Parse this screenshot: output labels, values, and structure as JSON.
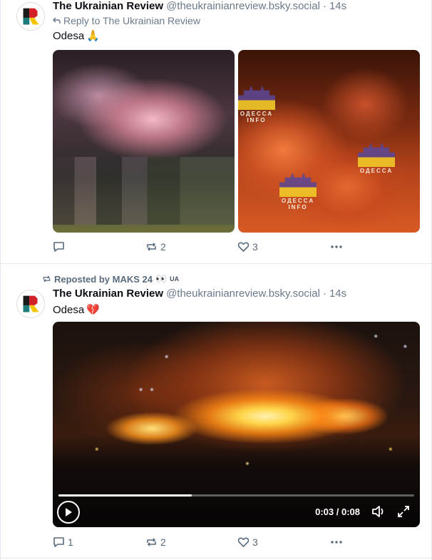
{
  "post1": {
    "author_name": "The Ukrainian Review",
    "author_handle": "@theukrainianreview.bsky.social",
    "separator": "·",
    "time": "14s",
    "reply_to": "Reply to The Ukrainian Review",
    "text": "Odesa",
    "emoji": "🙏",
    "image_watermark": "ОДЕССА",
    "image_watermark_sub": "INFO",
    "replies": "",
    "reposts": "2",
    "likes": "3"
  },
  "post2": {
    "repost_label": "Reposted by MAKS 24",
    "repost_emoji": "👀",
    "repost_suffix": "UA",
    "author_name": "The Ukrainian Review",
    "author_handle": "@theukrainianreview.bsky.social",
    "separator": "·",
    "time": "14s",
    "text": "Odesa",
    "emoji": "💔",
    "video": {
      "time_readout": "0:03 / 0:08",
      "progress": 0.375
    },
    "replies": "1",
    "reposts": "2",
    "likes": "3"
  },
  "colors": {
    "muted": "#6b7a8a",
    "border": "#e3e8ee",
    "logo_red": "#d21f26",
    "logo_yellow": "#f5c400",
    "logo_teal": "#1d7d7a"
  },
  "icons": [
    "reply-arrow-icon",
    "repost-icon",
    "comment-icon",
    "heart-icon",
    "more-icon",
    "play-icon",
    "volume-icon",
    "fullscreen-icon"
  ]
}
